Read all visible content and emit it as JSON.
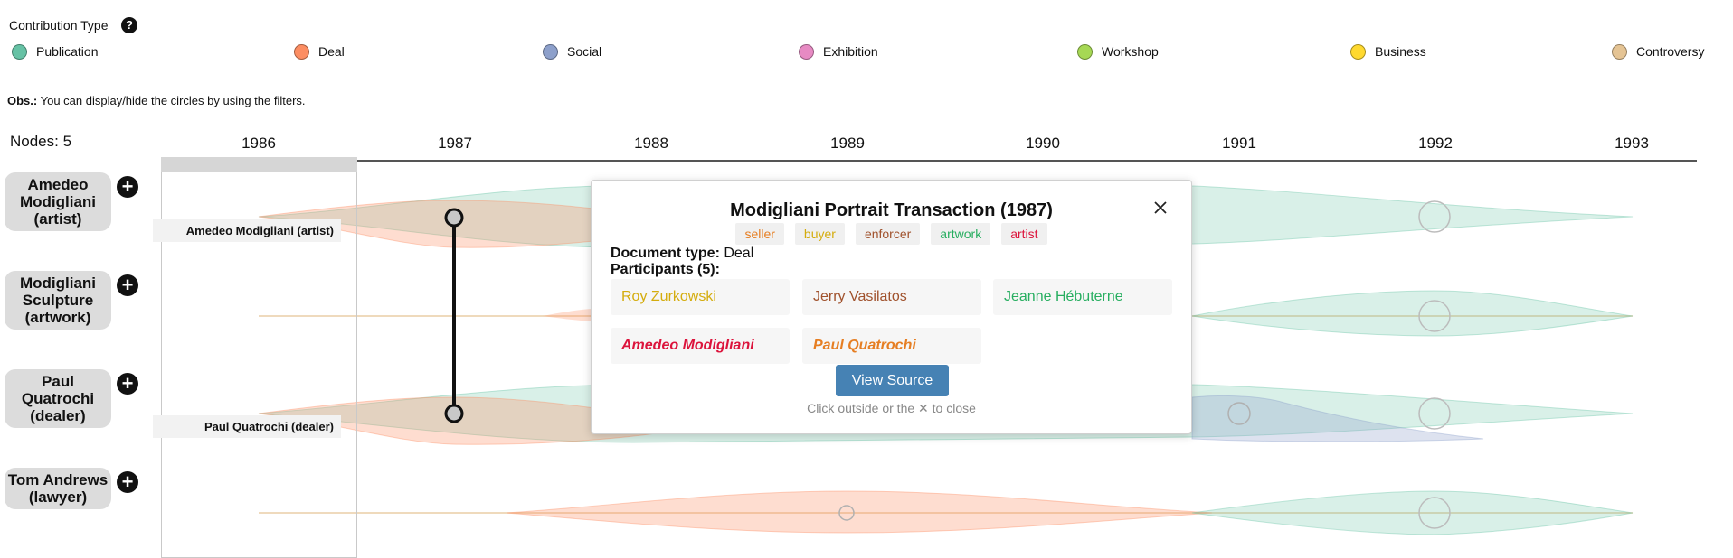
{
  "legend": {
    "title": "Contribution Type",
    "help": "?",
    "items": [
      {
        "label": "Publication",
        "color": "#66c2a5"
      },
      {
        "label": "Deal",
        "color": "#fc8d62"
      },
      {
        "label": "Social",
        "color": "#8da0cb"
      },
      {
        "label": "Exhibition",
        "color": "#e78ac3"
      },
      {
        "label": "Workshop",
        "color": "#a6d854"
      },
      {
        "label": "Business",
        "color": "#ffd92f"
      },
      {
        "label": "Controversy",
        "color": "#e5c494"
      }
    ]
  },
  "obs": {
    "label": "Obs.:",
    "text": " You can display/hide the circles by using the filters."
  },
  "nodes_count": "Nodes: 5",
  "years": [
    "1986",
    "1987",
    "1988",
    "1989",
    "1990",
    "1991",
    "1992",
    "1993"
  ],
  "rows": [
    {
      "label": "Amedeo Modigliani (artist)"
    },
    {
      "label": "Modigliani Sculpture (artwork)"
    },
    {
      "label": "Paul Quatrochi (dealer)"
    },
    {
      "label": "Tom Andrews (lawyer)"
    }
  ],
  "plus": "+",
  "node_tags": [
    "Amedeo Modigliani (artist)",
    "Paul Quatrochi (dealer)"
  ],
  "popup": {
    "title": "Modigliani Portrait Transaction (1987)",
    "roles": [
      {
        "label": "seller",
        "color": "#e67e22"
      },
      {
        "label": "buyer",
        "color": "#d4ac0d"
      },
      {
        "label": "enforcer",
        "color": "#a0522d"
      },
      {
        "label": "artwork",
        "color": "#27ae60"
      },
      {
        "label": "artist",
        "color": "#dc143c"
      }
    ],
    "doc_type_label": "Document type:",
    "doc_type_value": " Deal",
    "participants_label": "Participants (5):",
    "participants": [
      {
        "name": "Roy Zurkowski",
        "color": "#d4ac0d"
      },
      {
        "name": "Jerry Vasilatos",
        "color": "#a0522d"
      },
      {
        "name": "Jeanne Hébuterne",
        "color": "#27ae60"
      },
      {
        "name": "Amedeo Modigliani",
        "color": "#dc143c"
      },
      {
        "name": "Paul Quatrochi",
        "color": "#e67e22"
      }
    ],
    "view_source": "View Source",
    "close_hint": "Click outside or the ✕ to close"
  }
}
